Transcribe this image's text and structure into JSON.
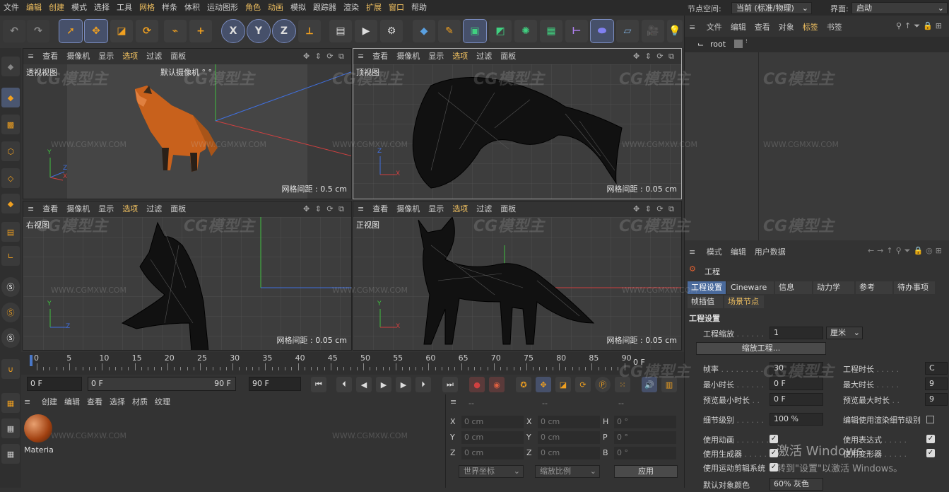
{
  "menu": [
    "文件",
    "编辑",
    "创建",
    "模式",
    "选择",
    "工具",
    "网格",
    "样条",
    "体积",
    "运动图形",
    "角色",
    "动画",
    "模拟",
    "跟踪器",
    "渲染",
    "扩展",
    "窗口",
    "帮助"
  ],
  "menu_highlight": [
    "编辑",
    "创建",
    "网格",
    "角色",
    "动画",
    "扩展",
    "窗口"
  ],
  "nodespace": {
    "label": "节点空间:",
    "value": "当前 (标准/物理)"
  },
  "interface": {
    "label": "界面:",
    "value": "启动"
  },
  "toolbar": {
    "x": "X",
    "y": "Y",
    "z": "Z"
  },
  "viewport_menu": [
    "查看",
    "摄像机",
    "显示",
    "选项",
    "过滤",
    "面板"
  ],
  "viewports": [
    {
      "label": "透视视图",
      "camera": "默认摄像机 ° °",
      "grid": "网格间距 : 0.5 cm",
      "axis": [
        "Y",
        "Z",
        "X"
      ]
    },
    {
      "label": "顶视图",
      "grid": "网格间距 : 0.05 cm",
      "axis": [
        "Z",
        "X"
      ]
    },
    {
      "label": "右视图",
      "grid": "网格间距 : 0.05 cm",
      "axis": [
        "Y",
        "Z"
      ]
    },
    {
      "label": "正视图",
      "grid": "网格间距 : 0.05 cm",
      "axis": [
        "Y",
        "X"
      ]
    }
  ],
  "watermark": {
    "site": "WWW.CGMXW.COM",
    "logo": "CG模型主"
  },
  "timeline": {
    "ticks": [
      "0",
      "5",
      "10",
      "15",
      "20",
      "25",
      "30",
      "35",
      "40",
      "45",
      "50",
      "55",
      "60",
      "65",
      "70",
      "75",
      "80",
      "85",
      "90"
    ],
    "end": "0 F"
  },
  "transport": {
    "start": "0 F",
    "range_start": "0 F",
    "range_end": "90 F",
    "end": "90 F"
  },
  "material_menu": [
    "创建",
    "编辑",
    "查看",
    "选择",
    "材质",
    "纹理"
  ],
  "material": {
    "name": "Materia"
  },
  "coords": {
    "dash": "--",
    "rows": [
      [
        "X",
        "0 cm",
        "X",
        "0 cm",
        "H",
        "0 °"
      ],
      [
        "Y",
        "0 cm",
        "Y",
        "0 cm",
        "P",
        "0 °"
      ],
      [
        "Z",
        "0 cm",
        "Z",
        "0 cm",
        "B",
        "0 °"
      ]
    ],
    "world": "世界坐标",
    "scale": "缩放比例",
    "apply": "应用"
  },
  "object_manager": {
    "menu": [
      "文件",
      "编辑",
      "查看",
      "对象",
      "标签",
      "书签"
    ],
    "root": "root"
  },
  "attributes": {
    "menu": [
      "模式",
      "编辑",
      "用户数据"
    ],
    "title": "工程",
    "tabs": [
      "工程设置",
      "Cineware",
      "信息",
      "动力学",
      "参考",
      "待办事项"
    ],
    "tabs2": [
      "帧插值",
      "场景节点"
    ],
    "section": "工程设置",
    "scale_label": "工程缩放",
    "scale_value": "1",
    "scale_unit": "厘米",
    "scale_btn": "缩放工程...",
    "fps_label": "帧率",
    "fps": "30",
    "length_label": "工程时长",
    "length": "C",
    "min_label": "最小时长",
    "min": "0 F",
    "max_label": "最大时长",
    "max": "9",
    "pmin_label": "预览最小时长",
    "pmin": "0 F",
    "pmax_label": "预览最大时长",
    "pmax": "9",
    "lod_label": "细节级别",
    "lod": "100 %",
    "render_lod": "编辑使用渲染细节级别",
    "anim": "使用动画",
    "expr": "使用表达式",
    "gen": "使用生成器",
    "deform": "使用变形器",
    "mograph": "使用运动剪辑系统",
    "color_label": "默认对象颜色",
    "color": "60% 灰色",
    "activation1": "激活 Windows",
    "activation2": "转到\"设置\"以激活 Windows。"
  },
  "colors": {
    "accent": "#f0c060",
    "select": "#4a6a9c",
    "axis_x": "#d04040",
    "axis_y": "#40c040",
    "axis_z": "#4070e0"
  }
}
